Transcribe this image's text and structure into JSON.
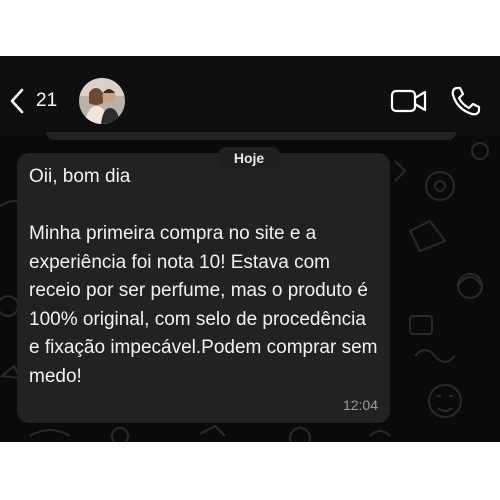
{
  "header": {
    "unread_count": "21",
    "icons": {
      "back": "chevron-left-icon",
      "video": "video-camera-icon",
      "call": "phone-icon"
    }
  },
  "chat": {
    "date_chip": "Hoje",
    "message": {
      "text": "Oii, bom dia\n\nMinha primeira compra no site e a experiência foi nota 10! Estava com receio por ser perfume, mas o produto é 100% original, com selo de procedência e fixação impecável.Podem comprar sem medo!",
      "time": "12:04"
    }
  },
  "colors": {
    "background": "#0b0b0b",
    "bubble": "#222224",
    "text": "#f2f2f2",
    "timestamp": "#9a9a9e"
  }
}
